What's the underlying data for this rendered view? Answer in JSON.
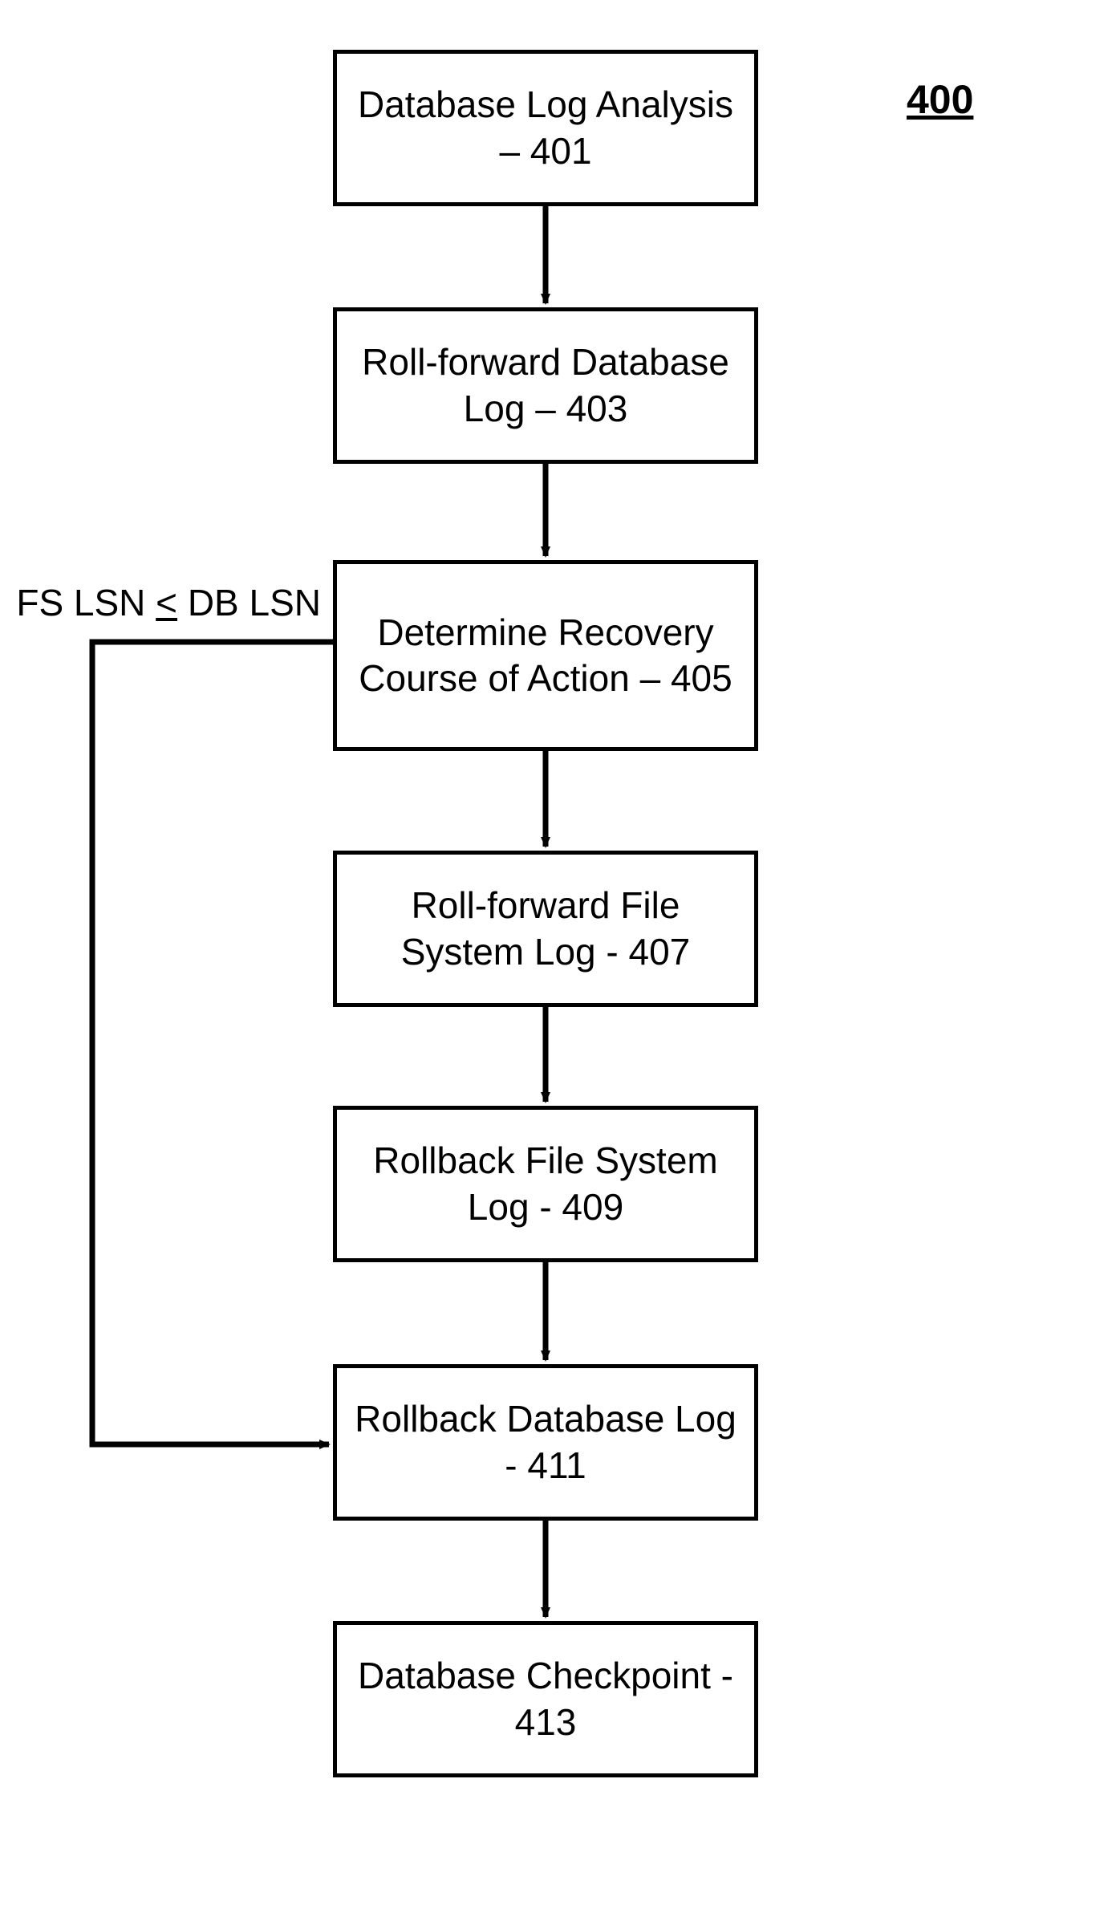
{
  "figure_label": "400",
  "branch_label_html": "FS LSN <span class=\"underline\">&lt;</span> DB LSN",
  "boxes": {
    "b401": "Database Log Analysis – 401",
    "b403": "Roll-forward Database Log – 403",
    "b405": "Determine Recovery Course of Action – 405",
    "b407": "Roll-forward File System Log - 407",
    "b409": "Rollback File System Log - 409",
    "b411": "Rollback Database Log - 411",
    "b413": "Database Checkpoint - 413"
  },
  "chart_data": {
    "type": "flowchart",
    "title": "400",
    "nodes": [
      {
        "id": "401",
        "label": "Database Log Analysis – 401"
      },
      {
        "id": "403",
        "label": "Roll-forward Database Log – 403"
      },
      {
        "id": "405",
        "label": "Determine Recovery Course of Action – 405"
      },
      {
        "id": "407",
        "label": "Roll-forward File System Log - 407"
      },
      {
        "id": "409",
        "label": "Rollback File System Log - 409"
      },
      {
        "id": "411",
        "label": "Rollback Database Log - 411"
      },
      {
        "id": "413",
        "label": "Database Checkpoint - 413"
      }
    ],
    "edges": [
      {
        "from": "401",
        "to": "403"
      },
      {
        "from": "403",
        "to": "405"
      },
      {
        "from": "405",
        "to": "407"
      },
      {
        "from": "405",
        "to": "411",
        "label": "FS LSN ≤ DB LSN"
      },
      {
        "from": "407",
        "to": "409"
      },
      {
        "from": "409",
        "to": "411"
      },
      {
        "from": "411",
        "to": "413"
      }
    ]
  }
}
